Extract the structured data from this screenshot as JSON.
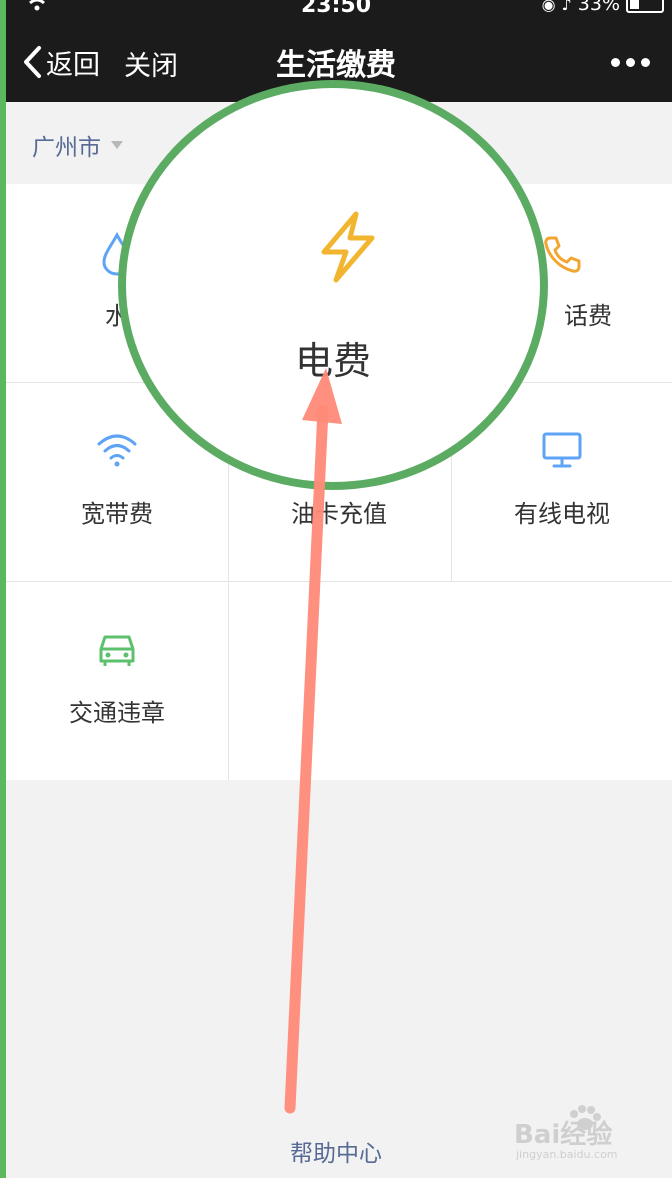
{
  "status_bar": {
    "time": "23:50",
    "battery_text": "33%"
  },
  "nav": {
    "back_label": "返回",
    "close_label": "关闭",
    "title": "生活缴费"
  },
  "city": {
    "name": "广州市"
  },
  "services": [
    {
      "label": "水",
      "icon": "water-drop-icon"
    },
    {
      "label": "",
      "icon": "lightning-icon"
    },
    {
      "label": "话费",
      "icon": "phone-icon"
    },
    {
      "label": "宽带费",
      "icon": "wifi-icon"
    },
    {
      "label": "油卡充值",
      "icon": "fuel-card-icon"
    },
    {
      "label": "有线电视",
      "icon": "tv-monitor-icon"
    },
    {
      "label": "交通违章",
      "icon": "car-icon"
    }
  ],
  "magnifier": {
    "label": "电费",
    "icon": "lightning-icon"
  },
  "footer": {
    "help_label": "帮助中心"
  },
  "watermark": {
    "main": "Bai经验",
    "sub": "jingyan.baidu.com"
  },
  "colors": {
    "navbar": "#1b1b1b",
    "link": "#576b95",
    "annotation_circle": "#5cab63",
    "annotation_arrow": "#ff8a78",
    "water_icon": "#5ea3f5",
    "lightning_icon": "#f2b530",
    "phone_icon": "#f2a530",
    "wifi_icon": "#5ea3f5",
    "tv_icon": "#5ea3f5",
    "car_icon": "#5cc06c"
  }
}
